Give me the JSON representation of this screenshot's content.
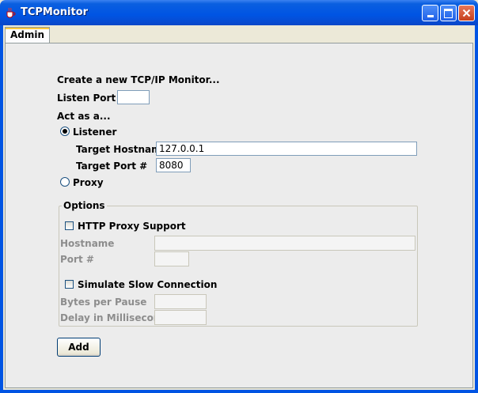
{
  "window": {
    "title": "TCPMonitor"
  },
  "tabs": [
    {
      "label": "Admin"
    }
  ],
  "form": {
    "heading": "Create a new TCP/IP Monitor...",
    "listen_port_label": "Listen Port #",
    "listen_port_value": "",
    "act_as_label": "Act as a...",
    "listener_label": "Listener",
    "listener_selected": true,
    "target_hostname_label": "Target Hostname",
    "target_hostname_value": "127.0.0.1",
    "target_port_label": "Target Port #",
    "target_port_value": "8080",
    "proxy_label": "Proxy",
    "proxy_selected": false
  },
  "options": {
    "legend": "Options",
    "http_proxy_support_label": "HTTP Proxy Support",
    "http_proxy_support_checked": false,
    "hostname_label": "Hostname",
    "hostname_value": "",
    "port_label": "Port #",
    "port_value": "",
    "simulate_slow_label": "Simulate Slow Connection",
    "simulate_slow_checked": false,
    "bytes_per_pause_label": "Bytes per Pause",
    "bytes_per_pause_value": "",
    "delay_label": "Delay in Milliseconds",
    "delay_value": ""
  },
  "actions": {
    "add_label": "Add"
  },
  "icons": {
    "app": "java-cup-icon",
    "minimize": "minimize-icon",
    "maximize": "maximize-icon",
    "close": "close-icon"
  },
  "colors": {
    "titlebar": "#0054e3",
    "panel": "#ececec",
    "disabled_text": "#8d8d8d"
  }
}
